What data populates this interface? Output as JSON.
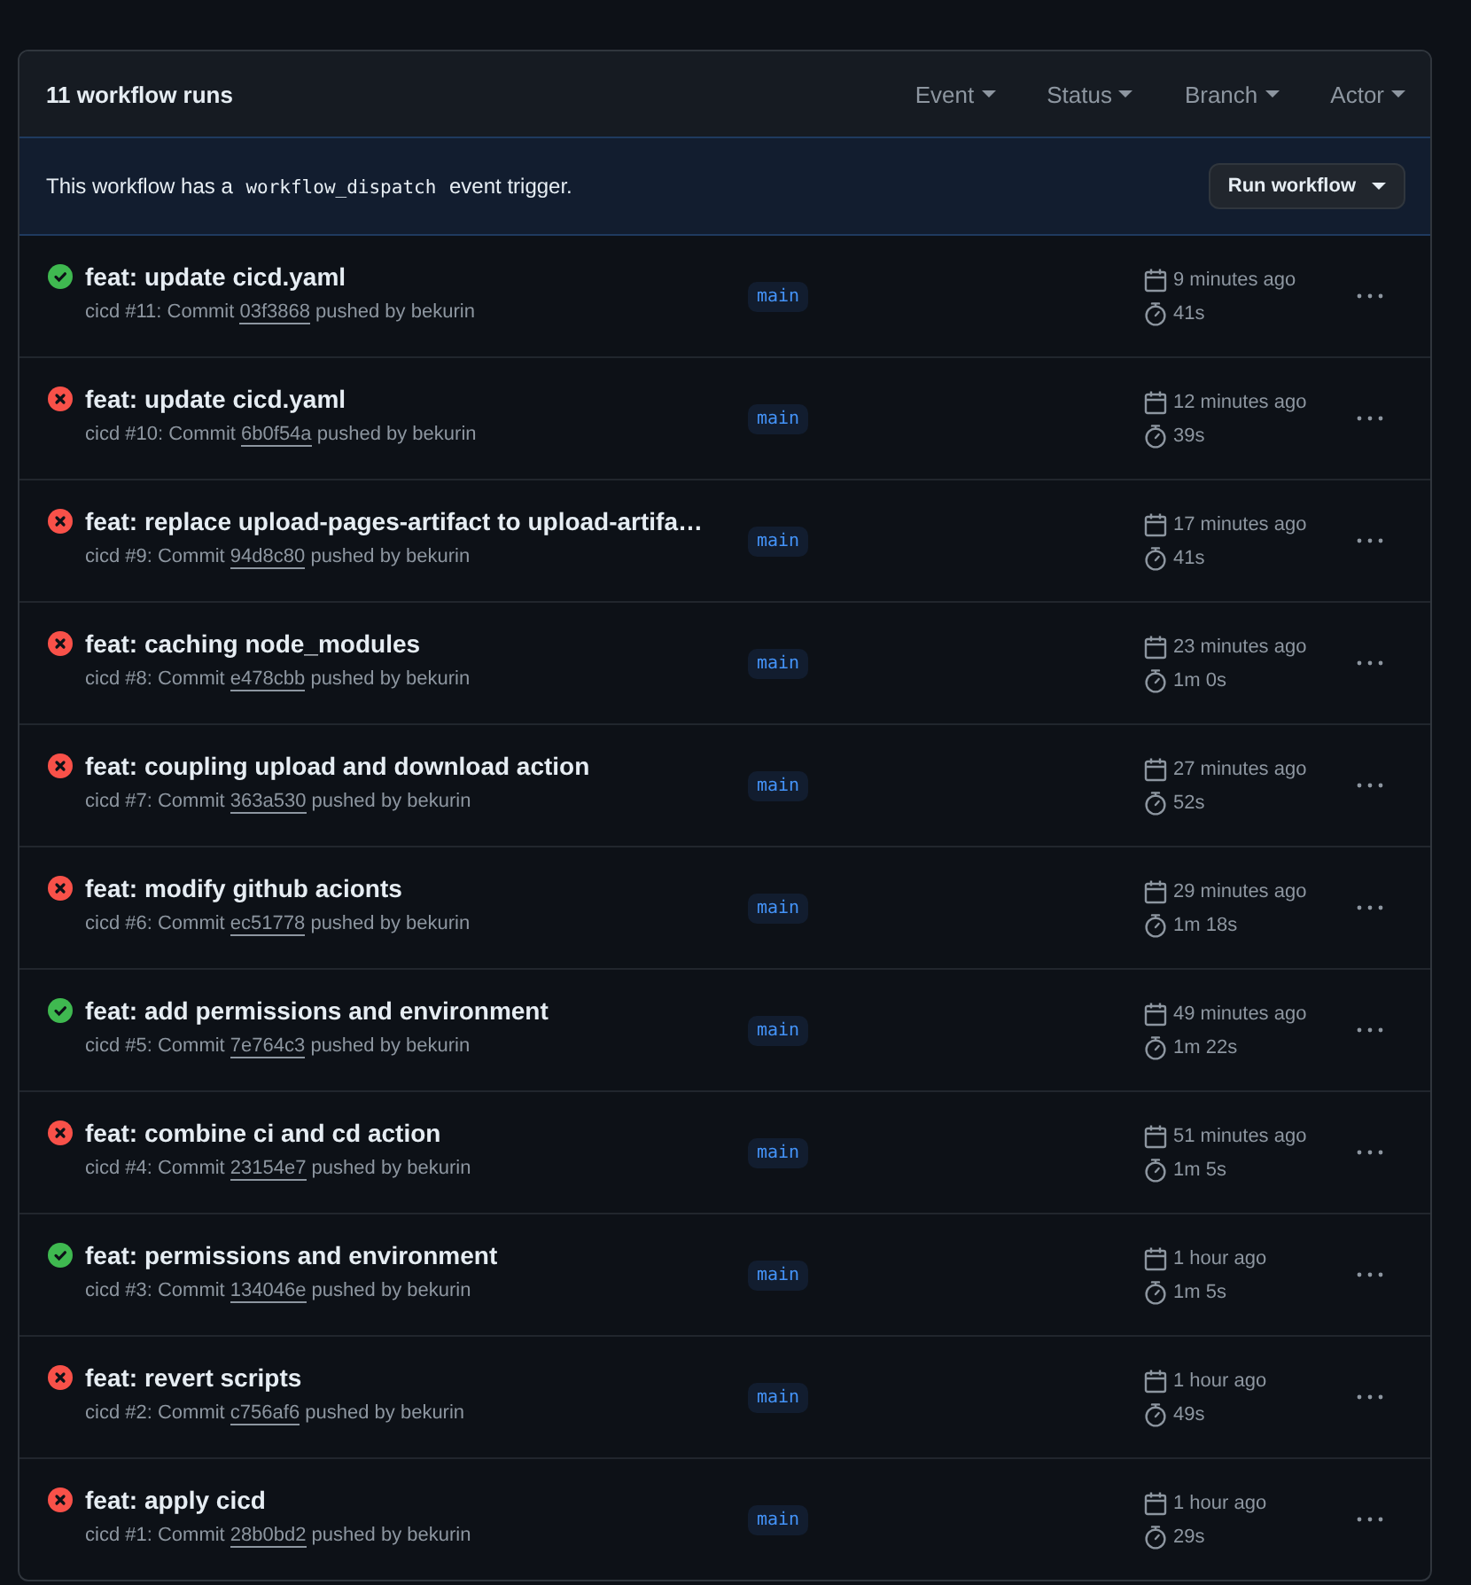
{
  "header": {
    "title": "11 workflow runs",
    "filters": [
      "Event",
      "Status",
      "Branch",
      "Actor"
    ]
  },
  "banner": {
    "text_before": "This workflow has a",
    "code": "workflow_dispatch",
    "text_after": "event trigger.",
    "button": "Run workflow"
  },
  "runs": [
    {
      "kind": "success",
      "title": "feat: update cicd.yaml",
      "prefix": "cicd #11: Commit",
      "commit": "03f3868",
      "suffix": "pushed by bekurin",
      "branch": "main",
      "time": "9 minutes ago",
      "duration": "41s"
    },
    {
      "kind": "failure",
      "title": "feat: update cicd.yaml",
      "prefix": "cicd #10: Commit",
      "commit": "6b0f54a",
      "suffix": "pushed by bekurin",
      "branch": "main",
      "time": "12 minutes ago",
      "duration": "39s"
    },
    {
      "kind": "failure",
      "title": "feat: replace upload-pages-artifact to upload-artifa…",
      "prefix": "cicd #9: Commit",
      "commit": "94d8c80",
      "suffix": "pushed by bekurin",
      "branch": "main",
      "time": "17 minutes ago",
      "duration": "41s"
    },
    {
      "kind": "failure",
      "title": "feat: caching node_modules",
      "prefix": "cicd #8: Commit",
      "commit": "e478cbb",
      "suffix": "pushed by bekurin",
      "branch": "main",
      "time": "23 minutes ago",
      "duration": "1m 0s"
    },
    {
      "kind": "failure",
      "title": "feat: coupling upload and download action",
      "prefix": "cicd #7: Commit",
      "commit": "363a530",
      "suffix": "pushed by bekurin",
      "branch": "main",
      "time": "27 minutes ago",
      "duration": "52s"
    },
    {
      "kind": "failure",
      "title": "feat: modify github acionts",
      "prefix": "cicd #6: Commit",
      "commit": "ec51778",
      "suffix": "pushed by bekurin",
      "branch": "main",
      "time": "29 minutes ago",
      "duration": "1m 18s"
    },
    {
      "kind": "success",
      "title": "feat: add permissions and environment",
      "prefix": "cicd #5: Commit",
      "commit": "7e764c3",
      "suffix": "pushed by bekurin",
      "branch": "main",
      "time": "49 minutes ago",
      "duration": "1m 22s"
    },
    {
      "kind": "failure",
      "title": "feat: combine ci and cd action",
      "prefix": "cicd #4: Commit",
      "commit": "23154e7",
      "suffix": "pushed by bekurin",
      "branch": "main",
      "time": "51 minutes ago",
      "duration": "1m 5s"
    },
    {
      "kind": "success",
      "title": "feat: permissions and environment",
      "prefix": "cicd #3: Commit",
      "commit": "134046e",
      "suffix": "pushed by bekurin",
      "branch": "main",
      "time": "1 hour ago",
      "duration": "1m 5s"
    },
    {
      "kind": "failure",
      "title": "feat: revert scripts",
      "prefix": "cicd #2: Commit",
      "commit": "c756af6",
      "suffix": "pushed by bekurin",
      "branch": "main",
      "time": "1 hour ago",
      "duration": "49s"
    },
    {
      "kind": "failure",
      "title": "feat: apply cicd",
      "prefix": "cicd #1: Commit",
      "commit": "28b0bd2",
      "suffix": "pushed by bekurin",
      "branch": "main",
      "time": "1 hour ago",
      "duration": "29s"
    }
  ]
}
